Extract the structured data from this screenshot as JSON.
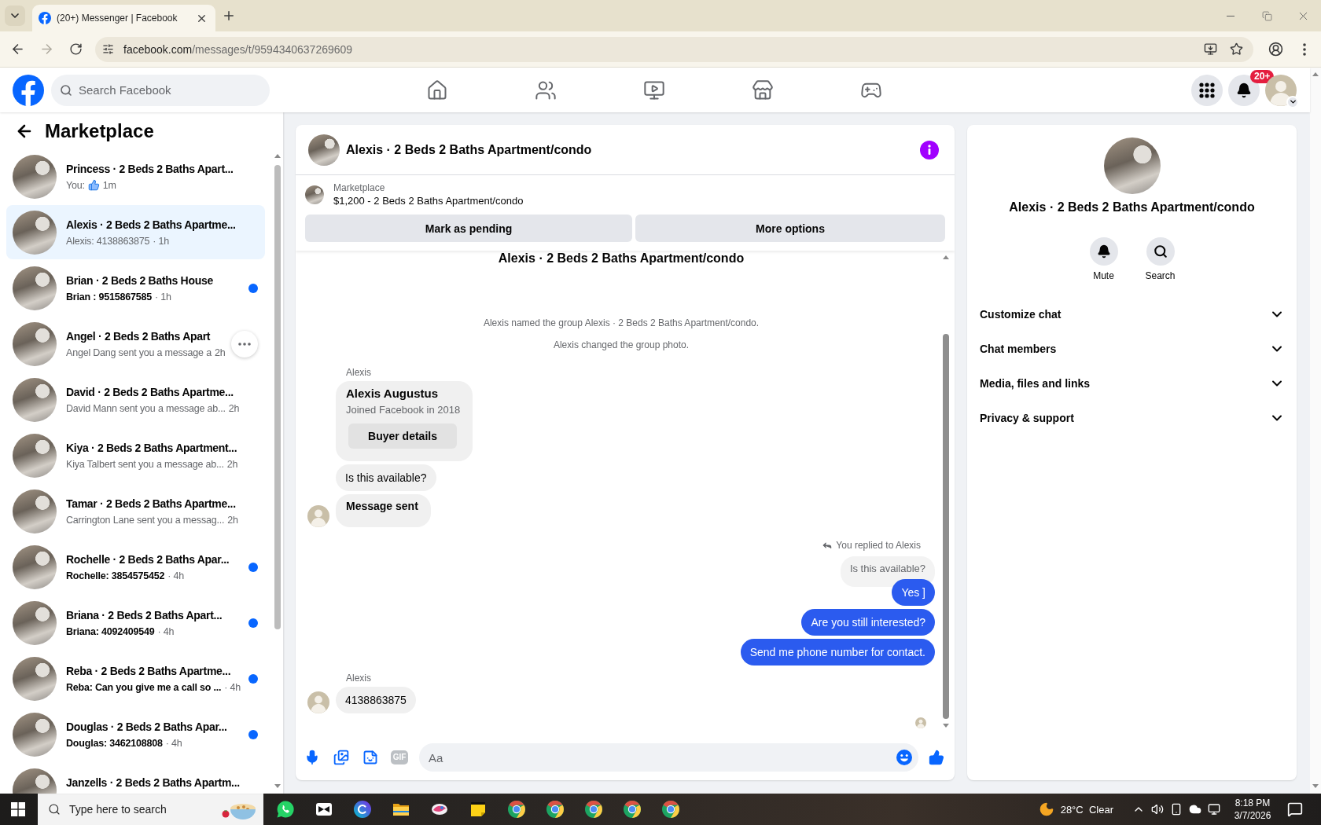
{
  "browser": {
    "tab": {
      "title": "(20+) Messenger | Facebook"
    },
    "address": {
      "host": "facebook.com",
      "path": "/messages/t/9594340637269609"
    }
  },
  "header": {
    "search": {
      "placeholder": "Search Facebook"
    },
    "nav": [
      {
        "kind": "home"
      },
      {
        "kind": "friends"
      },
      {
        "kind": "video"
      },
      {
        "kind": "marketplace"
      },
      {
        "kind": "gaming"
      }
    ],
    "notifications_badge": "20+"
  },
  "sidebar": {
    "title": "Marketplace",
    "conversations": [
      {
        "title": "Princess · 2 Beds 2 Baths Apart...",
        "kind": "like",
        "subtitle": "You:",
        "time": "1m",
        "unread": false,
        "selected": false,
        "hovered": false
      },
      {
        "title": "Alexis · 2 Beds 2 Baths Apartme...",
        "kind": "text",
        "subtitle": "Alexis: 4138863875",
        "time": "· 1h",
        "unread": false,
        "selected": true,
        "hovered": false
      },
      {
        "title": "Brian · 2 Beds 2 Baths House",
        "kind": "text",
        "subtitle": "Brian : 9515867585",
        "time": "· 1h",
        "unread": true,
        "selected": false,
        "hovered": false
      },
      {
        "title": "Angel · 2 Beds 2 Baths Apart",
        "kind": "text",
        "subtitle": "Angel Dang sent you a message a",
        "time": "2h",
        "unread": false,
        "selected": false,
        "hovered": true
      },
      {
        "title": "David · 2 Beds 2 Baths Apartme...",
        "kind": "text",
        "subtitle": "David Mann sent you a message ab...",
        "time": "2h",
        "unread": false,
        "selected": false,
        "hovered": false
      },
      {
        "title": "Kiya · 2 Beds 2 Baths Apartment...",
        "kind": "text",
        "subtitle": "Kiya Talbert sent you a message ab...",
        "time": "2h",
        "unread": false,
        "selected": false,
        "hovered": false
      },
      {
        "title": "Tamar · 2 Beds 2 Baths Apartme...",
        "kind": "text",
        "subtitle": "Carrington Lane sent you a messag...",
        "time": "2h",
        "unread": false,
        "selected": false,
        "hovered": false
      },
      {
        "title": "Rochelle · 2 Beds 2 Baths Apar...",
        "kind": "text",
        "subtitle": "Rochelle: 3854575452",
        "time": "· 4h",
        "unread": true,
        "selected": false,
        "hovered": false
      },
      {
        "title": "Briana · 2 Beds 2 Baths Apart...",
        "kind": "text",
        "subtitle": "Briana: 4092409549",
        "time": "· 4h",
        "unread": true,
        "selected": false,
        "hovered": false
      },
      {
        "title": "Reba · 2 Beds 2 Baths Apartme...",
        "kind": "text",
        "subtitle": "Reba: Can you give me a call so ...",
        "time": "· 4h",
        "unread": true,
        "selected": false,
        "hovered": false
      },
      {
        "title": "Douglas · 2 Beds 2 Baths Apar...",
        "kind": "text",
        "subtitle": "Douglas: 3462108808",
        "time": "· 4h",
        "unread": true,
        "selected": false,
        "hovered": false
      },
      {
        "title": "Janzells · 2 Beds 2 Baths Apartm...",
        "unread": false,
        "selected": false,
        "hovered": false
      }
    ]
  },
  "chat": {
    "title": "Alexis · 2 Beds 2 Baths Apartment/condo",
    "listing": {
      "label": "Marketplace",
      "title": "$1,200 - 2 Beds 2 Baths Apartment/condo"
    },
    "actions": [
      "Mark as pending",
      "More options"
    ],
    "thread": [
      {
        "kind": "heading",
        "text": "Alexis · 2 Beds 2 Baths Apartment/condo"
      },
      {
        "kind": "system",
        "text": "Alexis named the group Alexis · 2 Beds 2 Baths Apartment/condo."
      },
      {
        "kind": "system",
        "text": "Alexis changed the group photo."
      },
      {
        "kind": "incoming",
        "sender": "Alexis",
        "messages": [
          {
            "kind": "profile",
            "name": "Alexis Augustus",
            "detail": "Joined Facebook in 2018",
            "button": "Buyer details"
          },
          {
            "kind": "text",
            "text": "Is this available?"
          },
          {
            "kind": "status",
            "text": "Message sent"
          }
        ]
      },
      {
        "kind": "outgoing",
        "reply_note": "You replied to Alexis",
        "quote": "Is this available?",
        "messages": [
          {
            "kind": "text",
            "text": "Yes ]"
          },
          {
            "kind": "text",
            "text": "Are you still interested?"
          },
          {
            "kind": "text",
            "text": "Send me phone number for contact."
          }
        ]
      },
      {
        "kind": "incoming",
        "sender": "Alexis",
        "messages": [
          {
            "kind": "text",
            "text": "4138863875"
          }
        ]
      }
    ],
    "composer": {
      "gif_label": "GIF",
      "placeholder": "Aa"
    }
  },
  "details": {
    "name": "Alexis · 2 Beds 2 Baths Apartment/condo",
    "actions": [
      {
        "kind": "mute",
        "label": "Mute"
      },
      {
        "kind": "search",
        "label": "Search"
      }
    ],
    "sections": [
      {
        "label": "Customize chat",
        "expanded": false
      },
      {
        "label": "Chat members",
        "expanded": false
      },
      {
        "label": "Media, files and links",
        "expanded": false
      },
      {
        "label": "Privacy & support",
        "expanded": false
      }
    ]
  },
  "taskbar": {
    "search": {
      "placeholder": "Type here to search"
    },
    "weather": "28°C  Clear",
    "time": "8:18 PM",
    "date": "3/7/2026"
  }
}
